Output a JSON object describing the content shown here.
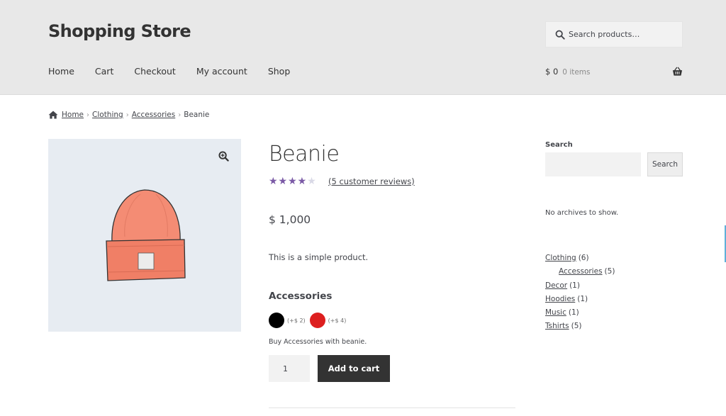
{
  "header": {
    "site_title": "Shopping Store",
    "search_placeholder": "Search products…",
    "nav": [
      "Home",
      "Cart",
      "Checkout",
      "My account",
      "Shop"
    ],
    "cart_total": "$ 0",
    "cart_items": "0 items"
  },
  "breadcrumb": {
    "home": "Home",
    "clothing": "Clothing",
    "accessories": "Accessories",
    "current": "Beanie",
    "separator": "›"
  },
  "product": {
    "title": "Beanie",
    "rating_fraction": 0.7,
    "review_link": "(5 customer reviews)",
    "price": "$ 1,000",
    "short_description": "This is a simple product.",
    "addon_title": "Accessories",
    "swatches": [
      {
        "color": "#000000",
        "price": "(+$ 2)"
      },
      {
        "color": "#dd1f1f",
        "price": "(+$ 4)"
      }
    ],
    "addon_description": "Buy Accessories with beanie.",
    "quantity": "1",
    "add_to_cart_label": "Add to cart",
    "image_bg_color": "#e7ecf2",
    "star_color": "#7b5aa6"
  },
  "sidebar": {
    "search_label": "Search",
    "search_button": "Search",
    "no_archives": "No archives to show.",
    "categories": [
      {
        "name": "Clothing",
        "count": "(6)"
      },
      {
        "name": "Accessories",
        "count": "(5)"
      },
      {
        "name": "Decor",
        "count": "(1)"
      },
      {
        "name": "Hoodies",
        "count": "(1)"
      },
      {
        "name": "Music",
        "count": "(1)"
      },
      {
        "name": "Tshirts",
        "count": "(5)"
      }
    ]
  }
}
